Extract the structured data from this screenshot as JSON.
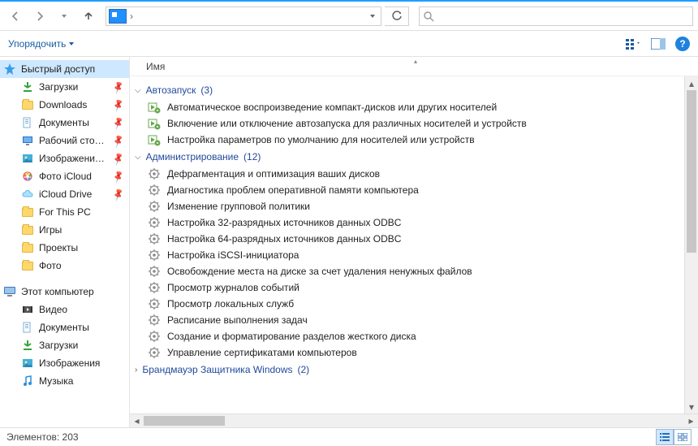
{
  "nav": {
    "path_sep": "›"
  },
  "toolbar": {
    "organize": "Упорядочить"
  },
  "columns": {
    "name": "Имя"
  },
  "sidebar": {
    "quick": {
      "label": "Быстрый доступ",
      "color": "#3a9de8"
    },
    "items": [
      {
        "label": "Загрузки",
        "icon": "download",
        "pinned": true
      },
      {
        "label": "Downloads",
        "icon": "folder",
        "pinned": true
      },
      {
        "label": "Документы",
        "icon": "docs",
        "pinned": true
      },
      {
        "label": "Рабочий сто…",
        "icon": "desktop",
        "pinned": true
      },
      {
        "label": "Изображени…",
        "icon": "pictures",
        "pinned": true
      },
      {
        "label": "Фото iCloud",
        "icon": "icloud-photo",
        "pinned": true
      },
      {
        "label": "iCloud Drive",
        "icon": "icloud",
        "pinned": true
      },
      {
        "label": "For This PC",
        "icon": "folder",
        "pinned": false
      },
      {
        "label": "Игры",
        "icon": "folder",
        "pinned": false
      },
      {
        "label": "Проекты",
        "icon": "folder",
        "pinned": false
      },
      {
        "label": "Фото",
        "icon": "folder",
        "pinned": false
      }
    ],
    "thispc": {
      "label": "Этот компьютер",
      "items": [
        {
          "label": "Видео",
          "icon": "video"
        },
        {
          "label": "Документы",
          "icon": "docs"
        },
        {
          "label": "Загрузки",
          "icon": "download"
        },
        {
          "label": "Изображения",
          "icon": "pictures"
        },
        {
          "label": "Музыка",
          "icon": "music"
        }
      ]
    }
  },
  "groups": [
    {
      "name": "Автозапуск",
      "count": "(3)",
      "expanded": true,
      "items": [
        {
          "icon": "autoplay",
          "label": "Автоматическое воспроизведение компакт-дисков или других носителей"
        },
        {
          "icon": "autoplay",
          "label": "Включение или отключение автозапуска для различных носителей и устройств"
        },
        {
          "icon": "autoplay",
          "label": "Настройка параметров по умолчанию для носителей или устройств"
        }
      ]
    },
    {
      "name": "Администрирование",
      "count": "(12)",
      "expanded": true,
      "items": [
        {
          "icon": "gear",
          "label": "Дефрагментация и оптимизация ваших дисков"
        },
        {
          "icon": "gear",
          "label": "Диагностика проблем оперативной памяти компьютера"
        },
        {
          "icon": "gear",
          "label": "Изменение групповой политики"
        },
        {
          "icon": "gear",
          "label": "Настройка 32-разрядных источников данных ODBC"
        },
        {
          "icon": "gear",
          "label": "Настройка 64-разрядных источников данных ODBC"
        },
        {
          "icon": "gear",
          "label": "Настройка iSCSI-инициатора"
        },
        {
          "icon": "gear",
          "label": "Освобождение места на диске за счет удаления ненужных файлов"
        },
        {
          "icon": "gear",
          "label": "Просмотр журналов событий"
        },
        {
          "icon": "gear",
          "label": "Просмотр локальных служб"
        },
        {
          "icon": "gear",
          "label": "Расписание выполнения задач"
        },
        {
          "icon": "gear",
          "label": "Создание и форматирование разделов жесткого диска"
        },
        {
          "icon": "gear",
          "label": "Управление сертификатами компьютеров"
        }
      ]
    },
    {
      "name": "Брандмауэр Защитника Windows",
      "count": "(2)",
      "expanded": false,
      "items": []
    }
  ],
  "status": {
    "label": "Элементов:",
    "count": "203"
  }
}
